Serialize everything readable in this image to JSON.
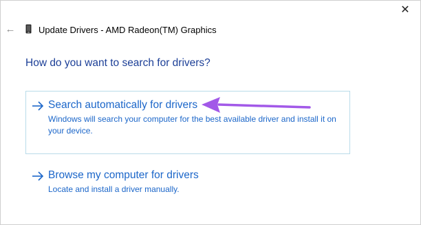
{
  "window": {
    "title": "Update Drivers - AMD Radeon(TM) Graphics",
    "close_glyph": "✕",
    "back_glyph": "←"
  },
  "main": {
    "question": "How do you want to search for drivers?",
    "options": [
      {
        "heading": "Search automatically for drivers",
        "description": "Windows will search your computer for the best available driver and install it on your device."
      },
      {
        "heading": "Browse my computer for drivers",
        "description": "Locate and install a driver manually."
      }
    ]
  },
  "icons": {
    "back": "back-arrow-icon",
    "close": "close-icon",
    "device": "graphics-device-icon",
    "option_arrow": "right-arrow-icon",
    "annotation": "purple-pointer-arrow"
  },
  "colors": {
    "question": "#1c3f97",
    "link": "#1b66c9",
    "box_border": "#b9dbe9",
    "annotation": "#a259e8"
  }
}
